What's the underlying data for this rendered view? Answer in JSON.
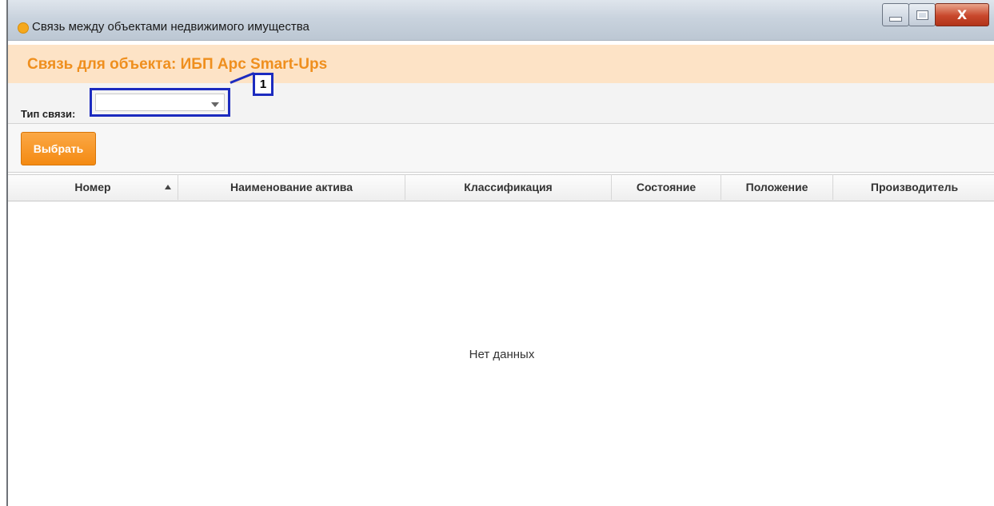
{
  "window": {
    "title": "Связь между объектами недвижимого имущества",
    "close_glyph": "X"
  },
  "header": {
    "title": "Связь для объекта: ИБП Apc Smart-Ups"
  },
  "filter": {
    "label": "Тип связи:",
    "value": ""
  },
  "annotation": {
    "number": "1"
  },
  "toolbar": {
    "select_label": "Выбрать"
  },
  "grid": {
    "columns": [
      "Номер",
      "Наименование актива",
      "Классификация",
      "Состояние",
      "Положение",
      "Производитель"
    ],
    "sorted_column": "Номер",
    "sort_direction": "ascending",
    "empty_text": "Нет данных"
  },
  "colors": {
    "accent": "#f48a12",
    "header_band": "#fde3c6",
    "callout": "#1c2bbf"
  }
}
